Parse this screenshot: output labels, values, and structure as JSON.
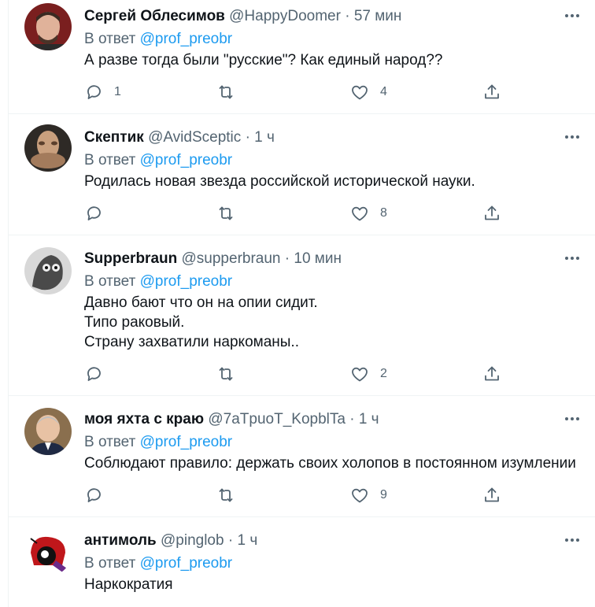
{
  "replying_prefix": "В ответ",
  "colors": {
    "accent": "#1d9bf0",
    "secondary_text": "#536471",
    "divider": "#eff3f4"
  },
  "icons": {
    "reply": "reply-icon",
    "retweet": "retweet-icon",
    "like": "heart-icon",
    "share": "share-icon",
    "more": "more-icon"
  },
  "tweets": [
    {
      "name": "Сергей Облесимов",
      "handle": "@HappyDoomer",
      "sep": "·",
      "time": "57 мин",
      "reply_to": "@prof_preobr",
      "text": "А разве тогда были \"русские\"? Как единый народ??",
      "replies": "1",
      "retweets": "",
      "likes": "4"
    },
    {
      "name": "Скептик",
      "handle": "@AvidSceptic",
      "sep": "·",
      "time": "1 ч",
      "reply_to": "@prof_preobr",
      "text": "Родилась новая звезда российской исторической науки.",
      "replies": "",
      "retweets": "",
      "likes": "8"
    },
    {
      "name": "Supperbraun",
      "handle": "@supperbraun",
      "sep": "·",
      "time": "10 мин",
      "reply_to": "@prof_preobr",
      "text": "Давно бают что он на опии сидит.\nТипо раковый.\nСтрану захватили наркоманы..",
      "replies": "",
      "retweets": "",
      "likes": "2"
    },
    {
      "name": "моя яхта с краю",
      "handle": "@7aTpuoT_KopblTa",
      "sep": "·",
      "time": "1 ч",
      "reply_to": "@prof_preobr",
      "text": "Соблюдают правило: держать своих холопов в постоянном изумлении",
      "replies": "",
      "retweets": "",
      "likes": "9"
    },
    {
      "name": "антимоль",
      "handle": "@pinglob",
      "sep": "·",
      "time": "1 ч",
      "reply_to": "@prof_preobr",
      "text": "Наркократия",
      "replies": "",
      "retweets": "",
      "likes": ""
    }
  ]
}
